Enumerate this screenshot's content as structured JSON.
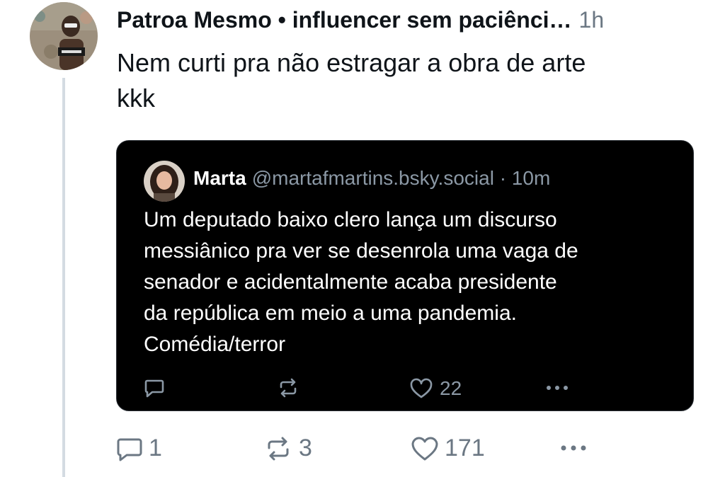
{
  "post": {
    "display_name": "Patroa Mesmo • influencer sem paciênci…",
    "timestamp": "1h",
    "text_line1": "Nem curti pra não estragar a obra de arte",
    "text_line2": "kkk",
    "actions": {
      "reply_count": "1",
      "repost_count": "3",
      "like_count": "171"
    }
  },
  "quote": {
    "display_name": "Marta",
    "handle_time": "@martafmartins.bsky.social · 10m",
    "lines": [
      "Um deputado baixo clero lança um discurso",
      "messiânico pra ver se desenrola uma vaga de",
      "senador e acidentalmente acaba presidente",
      "da república em meio a uma pandemia.",
      "Comédia/terror"
    ],
    "actions": {
      "like_count": "22"
    }
  },
  "icons": {
    "reply": "reply-icon",
    "repost": "repost-icon",
    "like": "heart-icon",
    "more": "more-icon"
  },
  "colors": {
    "text": "#0f1419",
    "muted": "#6b7783",
    "quote_bg": "#000000",
    "thread_line": "#d4dbe2"
  }
}
